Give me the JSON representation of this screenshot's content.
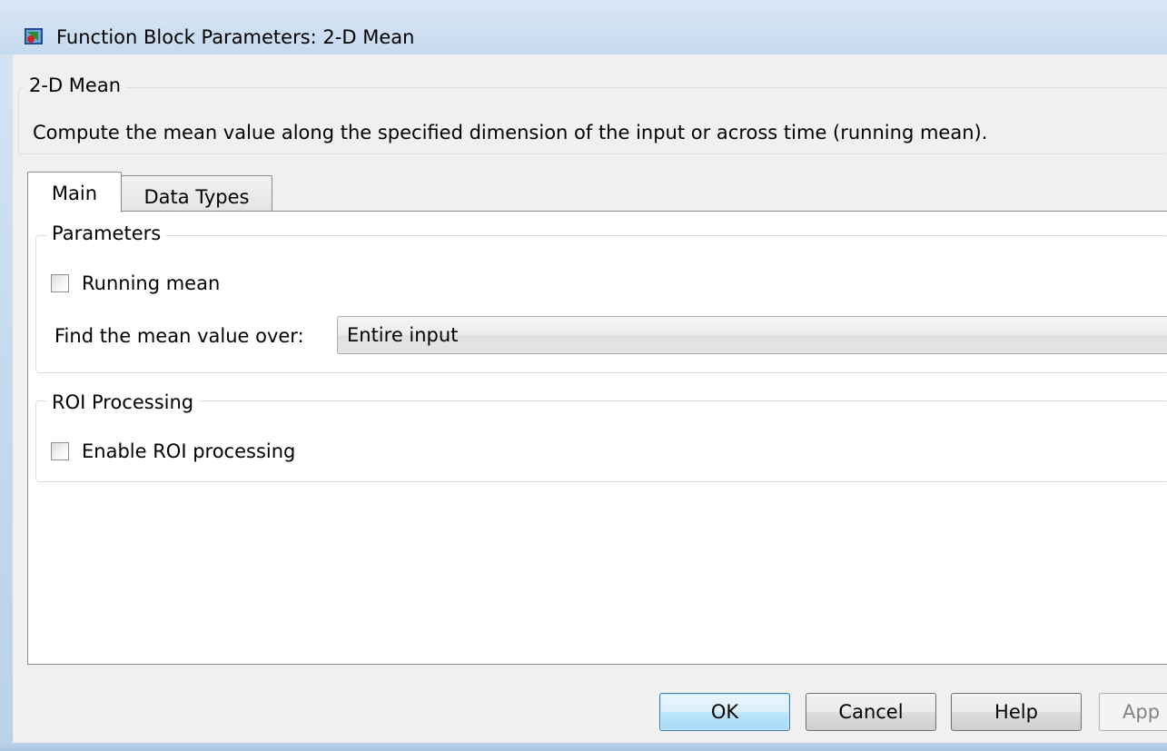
{
  "window": {
    "title": "Function Block Parameters: 2-D Mean",
    "icon": "simulink-block-icon"
  },
  "block": {
    "name": "2-D Mean",
    "description": "Compute the mean value along the specified dimension of the input or across time (running mean)."
  },
  "tabs": [
    {
      "label": "Main",
      "active": true
    },
    {
      "label": "Data Types",
      "active": false
    }
  ],
  "parameters": {
    "legend": "Parameters",
    "running_mean": {
      "label": "Running mean",
      "checked": false
    },
    "mean_over": {
      "label": "Find the mean value over:",
      "value": "Entire input"
    }
  },
  "roi": {
    "legend": "ROI Processing",
    "enable": {
      "label": "Enable ROI processing",
      "checked": false
    }
  },
  "buttons": {
    "ok": "OK",
    "cancel": "Cancel",
    "help": "Help",
    "apply": "App"
  },
  "colors": {
    "titlebar": "#cfe0f2",
    "dialog_bg": "#f0f0f0",
    "default_button_border": "#3c7fb1"
  }
}
